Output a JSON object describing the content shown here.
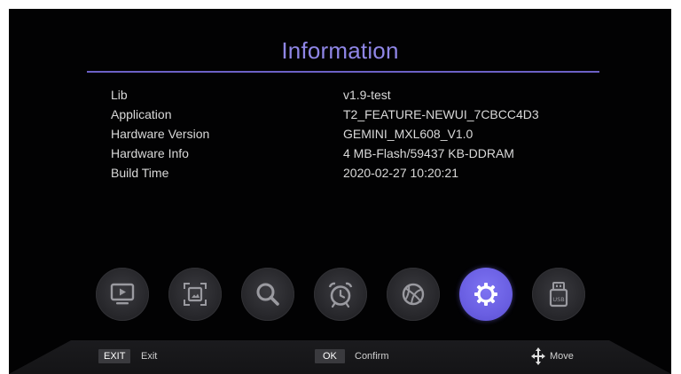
{
  "header": {
    "title": "Information"
  },
  "info_rows": [
    {
      "label": "Lib",
      "value": "v1.9-test"
    },
    {
      "label": "Application",
      "value": "T2_FEATURE-NEWUI_7CBCC4D3"
    },
    {
      "label": "Hardware Version",
      "value": "GEMINI_MXL608_V1.0"
    },
    {
      "label": "Hardware Info",
      "value": "4 MB-Flash/59437 KB-DDRAM"
    },
    {
      "label": "Build Time",
      "value": "2020-02-27 10:20:21"
    }
  ],
  "menu_icons": [
    {
      "name": "tv-icon",
      "active": false
    },
    {
      "name": "picture-icon",
      "active": false
    },
    {
      "name": "search-icon",
      "active": false
    },
    {
      "name": "alarm-clock-icon",
      "active": false
    },
    {
      "name": "globe-icon",
      "active": false
    },
    {
      "name": "gear-icon",
      "active": true
    },
    {
      "name": "usb-icon",
      "active": false
    }
  ],
  "footer": {
    "exit_key": "EXIT",
    "exit_label": "Exit",
    "ok_key": "OK",
    "ok_label": "Confirm",
    "move_label": "Move"
  },
  "colors": {
    "title": "#8f86e6",
    "rule": "#6c60c6",
    "active_icon": "#6a5fe2",
    "background": "#020203"
  }
}
